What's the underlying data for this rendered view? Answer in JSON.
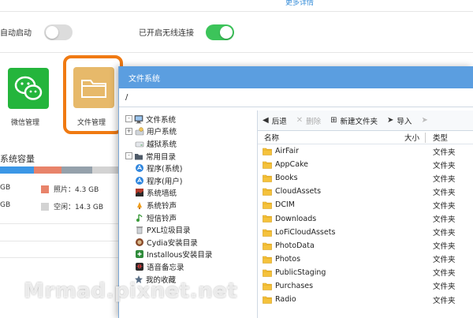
{
  "background": {
    "more_link": "更多详情",
    "settings": {
      "auto_start_label": "自动启动",
      "wireless_label": "已开启无线连接"
    },
    "tiles": {
      "wechat_label": "微信管理",
      "filemgr_label": "文件管理"
    },
    "capacity": {
      "title": "系统容量",
      "legend": [
        {
          "label": "GB",
          "color": ""
        },
        {
          "label": "照片：4.3 GB",
          "color": "#e8836a"
        },
        {
          "label": "GB",
          "color": ""
        },
        {
          "label": "空闲：14.3 GB",
          "color": "#d3d3d3"
        }
      ],
      "bar_colors": [
        "#3b97e6",
        "#e8836a",
        "#95a1ab",
        "#d3d3d3"
      ]
    }
  },
  "fs_window": {
    "title": "文件系统",
    "path": "/",
    "tree": [
      {
        "label": "文件系统",
        "toggle": "-",
        "icon": "computer-icon",
        "level": 0
      },
      {
        "label": "用户系统",
        "toggle": "+",
        "icon": "user-drive-icon",
        "level": 1
      },
      {
        "label": "越狱系统",
        "toggle": "",
        "icon": "drive-icon",
        "level": 1
      },
      {
        "label": "常用目录",
        "toggle": "-",
        "icon": "folder-dark-icon",
        "level": 0
      },
      {
        "label": "程序(系统)",
        "toggle": "",
        "icon": "appstore-icon",
        "level": 1
      },
      {
        "label": "程序(用户)",
        "toggle": "",
        "icon": "appstore-icon",
        "level": 1
      },
      {
        "label": "系统墙纸",
        "toggle": "",
        "icon": "wallpaper-icon",
        "level": 1
      },
      {
        "label": "系统铃声",
        "toggle": "",
        "icon": "bell-icon",
        "level": 1
      },
      {
        "label": "短信铃声",
        "toggle": "",
        "icon": "music-note-icon",
        "level": 1
      },
      {
        "label": "PXL垃圾目录",
        "toggle": "",
        "icon": "trash-icon",
        "level": 1
      },
      {
        "label": "Cydia安装目录",
        "toggle": "",
        "icon": "cydia-icon",
        "level": 1
      },
      {
        "label": "Installous安装目录",
        "toggle": "",
        "icon": "installous-icon",
        "level": 1
      },
      {
        "label": "语音备忘录",
        "toggle": "",
        "icon": "voice-memo-icon",
        "level": 1
      },
      {
        "label": "我的收藏",
        "toggle": "",
        "icon": "star-icon",
        "level": 0
      }
    ],
    "toolbar": {
      "back": "后退",
      "delete": "删除",
      "new_folder": "新建文件夹",
      "import": "导入"
    },
    "columns": {
      "name": "名称",
      "size": "大小",
      "type": "类型"
    },
    "files": [
      {
        "name": "AirFair",
        "type": "文件夹"
      },
      {
        "name": "AppCake",
        "type": "文件夹"
      },
      {
        "name": "Books",
        "type": "文件夹"
      },
      {
        "name": "CloudAssets",
        "type": "文件夹"
      },
      {
        "name": "DCIM",
        "type": "文件夹"
      },
      {
        "name": "Downloads",
        "type": "文件夹"
      },
      {
        "name": "LoFiCloudAssets",
        "type": "文件夹"
      },
      {
        "name": "PhotoData",
        "type": "文件夹"
      },
      {
        "name": "Photos",
        "type": "文件夹"
      },
      {
        "name": "PublicStaging",
        "type": "文件夹"
      },
      {
        "name": "Purchases",
        "type": "文件夹"
      },
      {
        "name": "Radio",
        "type": "文件夹"
      }
    ]
  },
  "watermark": "Mrmad.pixnet.net"
}
